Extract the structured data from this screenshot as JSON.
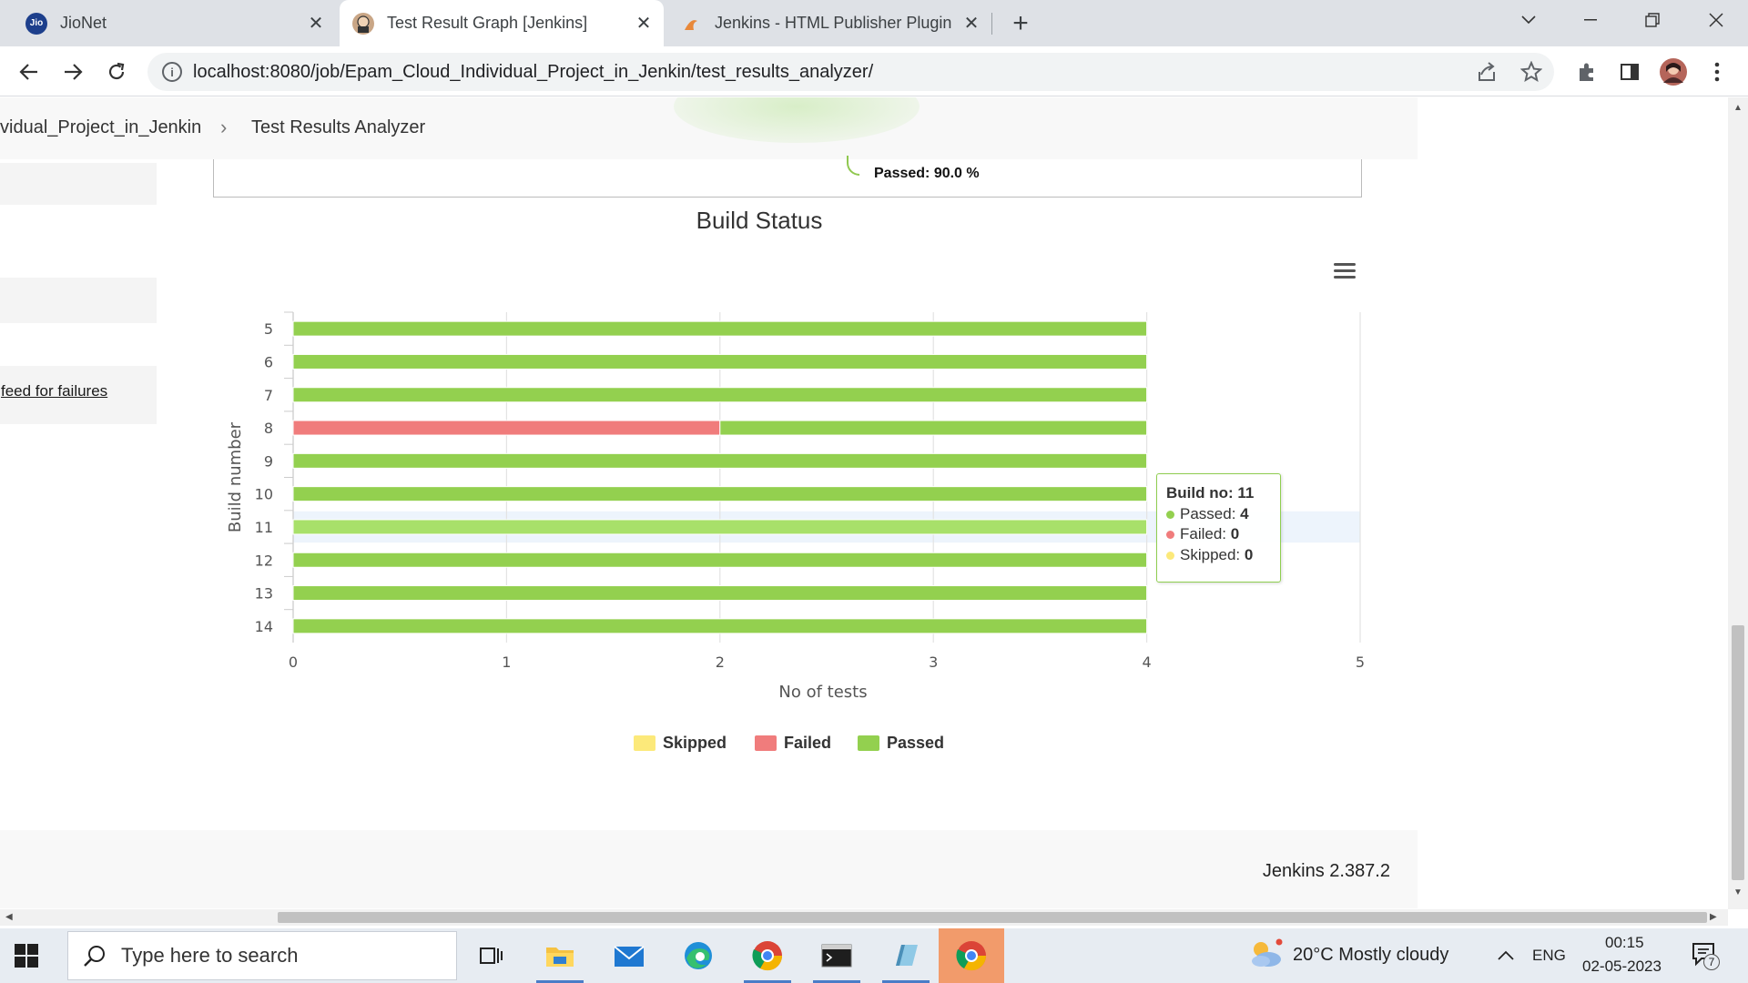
{
  "browser": {
    "tabs": [
      {
        "title": "JioNet",
        "active": false
      },
      {
        "title": "Test Result Graph [Jenkins]",
        "active": true
      },
      {
        "title": "Jenkins - HTML Publisher Plugin",
        "active": false
      }
    ],
    "url": "localhost:8080/job/Epam_Cloud_Individual_Project_in_Jenkin/test_results_analyzer/"
  },
  "page": {
    "breadcrumb": [
      "vidual_Project_in_Jenkin",
      "Test Results Analyzer"
    ],
    "side_link": "feed for failures",
    "pie_label": "Passed: 90.0 %",
    "footer_version": "Jenkins 2.387.2"
  },
  "chart_data": {
    "type": "bar",
    "orientation": "horizontal",
    "stacked": true,
    "title": "Build Status",
    "xlabel": "No of tests",
    "ylabel": "Build number",
    "categories": [
      "5",
      "6",
      "7",
      "8",
      "9",
      "10",
      "11",
      "12",
      "13",
      "14"
    ],
    "series": [
      {
        "name": "Skipped",
        "color": "#fce97a",
        "values": [
          0,
          0,
          0,
          0,
          0,
          0,
          0,
          0,
          0,
          0
        ]
      },
      {
        "name": "Failed",
        "color": "#f07c7c",
        "values": [
          0,
          0,
          0,
          2,
          0,
          0,
          0,
          0,
          0,
          0
        ]
      },
      {
        "name": "Passed",
        "color": "#93d04f",
        "values": [
          4,
          4,
          4,
          2,
          4,
          4,
          4,
          4,
          4,
          4
        ]
      }
    ],
    "xlim": [
      0,
      5
    ],
    "xticks": [
      "0",
      "1",
      "2",
      "3",
      "4",
      "5"
    ],
    "grid": true,
    "legend": "bottom-center",
    "highlighted_category": "11",
    "tooltip": {
      "title": "Build no: 11",
      "rows": [
        {
          "label": "Passed:",
          "value": "4",
          "color": "#93d04f"
        },
        {
          "label": "Failed:",
          "value": "0",
          "color": "#f07c7c"
        },
        {
          "label": "Skipped:",
          "value": "0",
          "color": "#fce97a"
        }
      ]
    }
  },
  "taskbar": {
    "search_placeholder": "Type here to search",
    "weather": "20°C  Mostly cloudy",
    "language": "ENG",
    "time": "00:15",
    "date": "02-05-2023",
    "notification_count": "7"
  }
}
